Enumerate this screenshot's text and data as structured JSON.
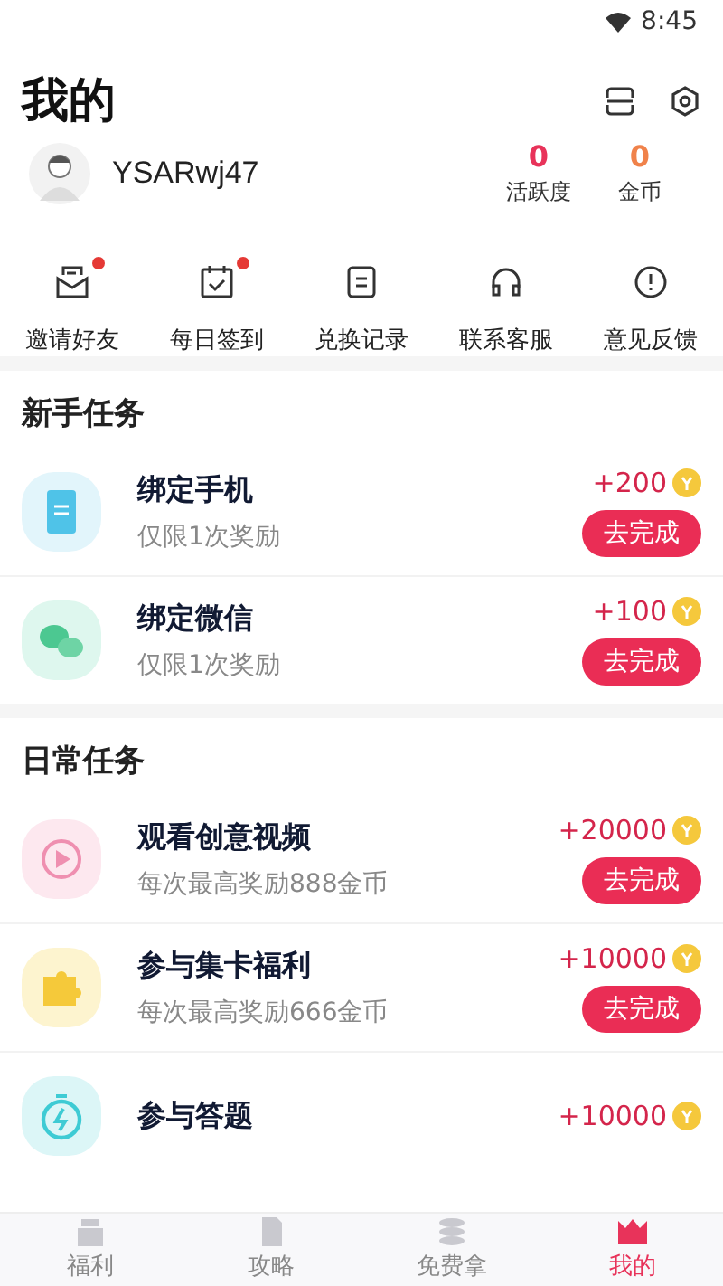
{
  "status_bar": {
    "time": "8:45"
  },
  "header": {
    "title": "我的"
  },
  "user": {
    "name": "YSARwj47"
  },
  "stats": [
    {
      "value": "0",
      "label": "活跃度",
      "color": "#e8335a"
    },
    {
      "value": "0",
      "label": "金币",
      "color": "#f0824a"
    }
  ],
  "shortcuts": [
    {
      "kind": "mail",
      "label": "邀请好友",
      "badge": true
    },
    {
      "kind": "calendar",
      "label": "每日签到",
      "badge": true
    },
    {
      "kind": "note",
      "label": "兑换记录",
      "badge": false
    },
    {
      "kind": "headset",
      "label": "联系客服",
      "badge": false
    },
    {
      "kind": "alert",
      "label": "意见反馈",
      "badge": false
    }
  ],
  "sections": [
    {
      "title": "新手任务",
      "tasks": [
        {
          "kind": "phone",
          "title": "绑定手机",
          "subtitle": "仅限1次奖励",
          "reward": "+200",
          "button": "去完成"
        },
        {
          "kind": "chat",
          "title": "绑定微信",
          "subtitle": "仅限1次奖励",
          "reward": "+100",
          "button": "去完成"
        }
      ]
    },
    {
      "title": "日常任务",
      "tasks": [
        {
          "kind": "play",
          "title": "观看创意视频",
          "subtitle": "每次最高奖励888金币",
          "reward": "+20000",
          "button": "去完成"
        },
        {
          "kind": "puzzle",
          "title": "参与集卡福利",
          "subtitle": "每次最高奖励666金币",
          "reward": "+10000",
          "button": "去完成"
        },
        {
          "kind": "timer",
          "title": "参与答题",
          "reward": "+10000"
        }
      ]
    }
  ],
  "tabs": [
    {
      "kind": "gift",
      "label": "福利",
      "selected": false
    },
    {
      "kind": "doc",
      "label": "攻略",
      "selected": false
    },
    {
      "kind": "stack",
      "label": "免费拿",
      "selected": false
    },
    {
      "kind": "crown",
      "label": "我的",
      "selected": true
    }
  ]
}
